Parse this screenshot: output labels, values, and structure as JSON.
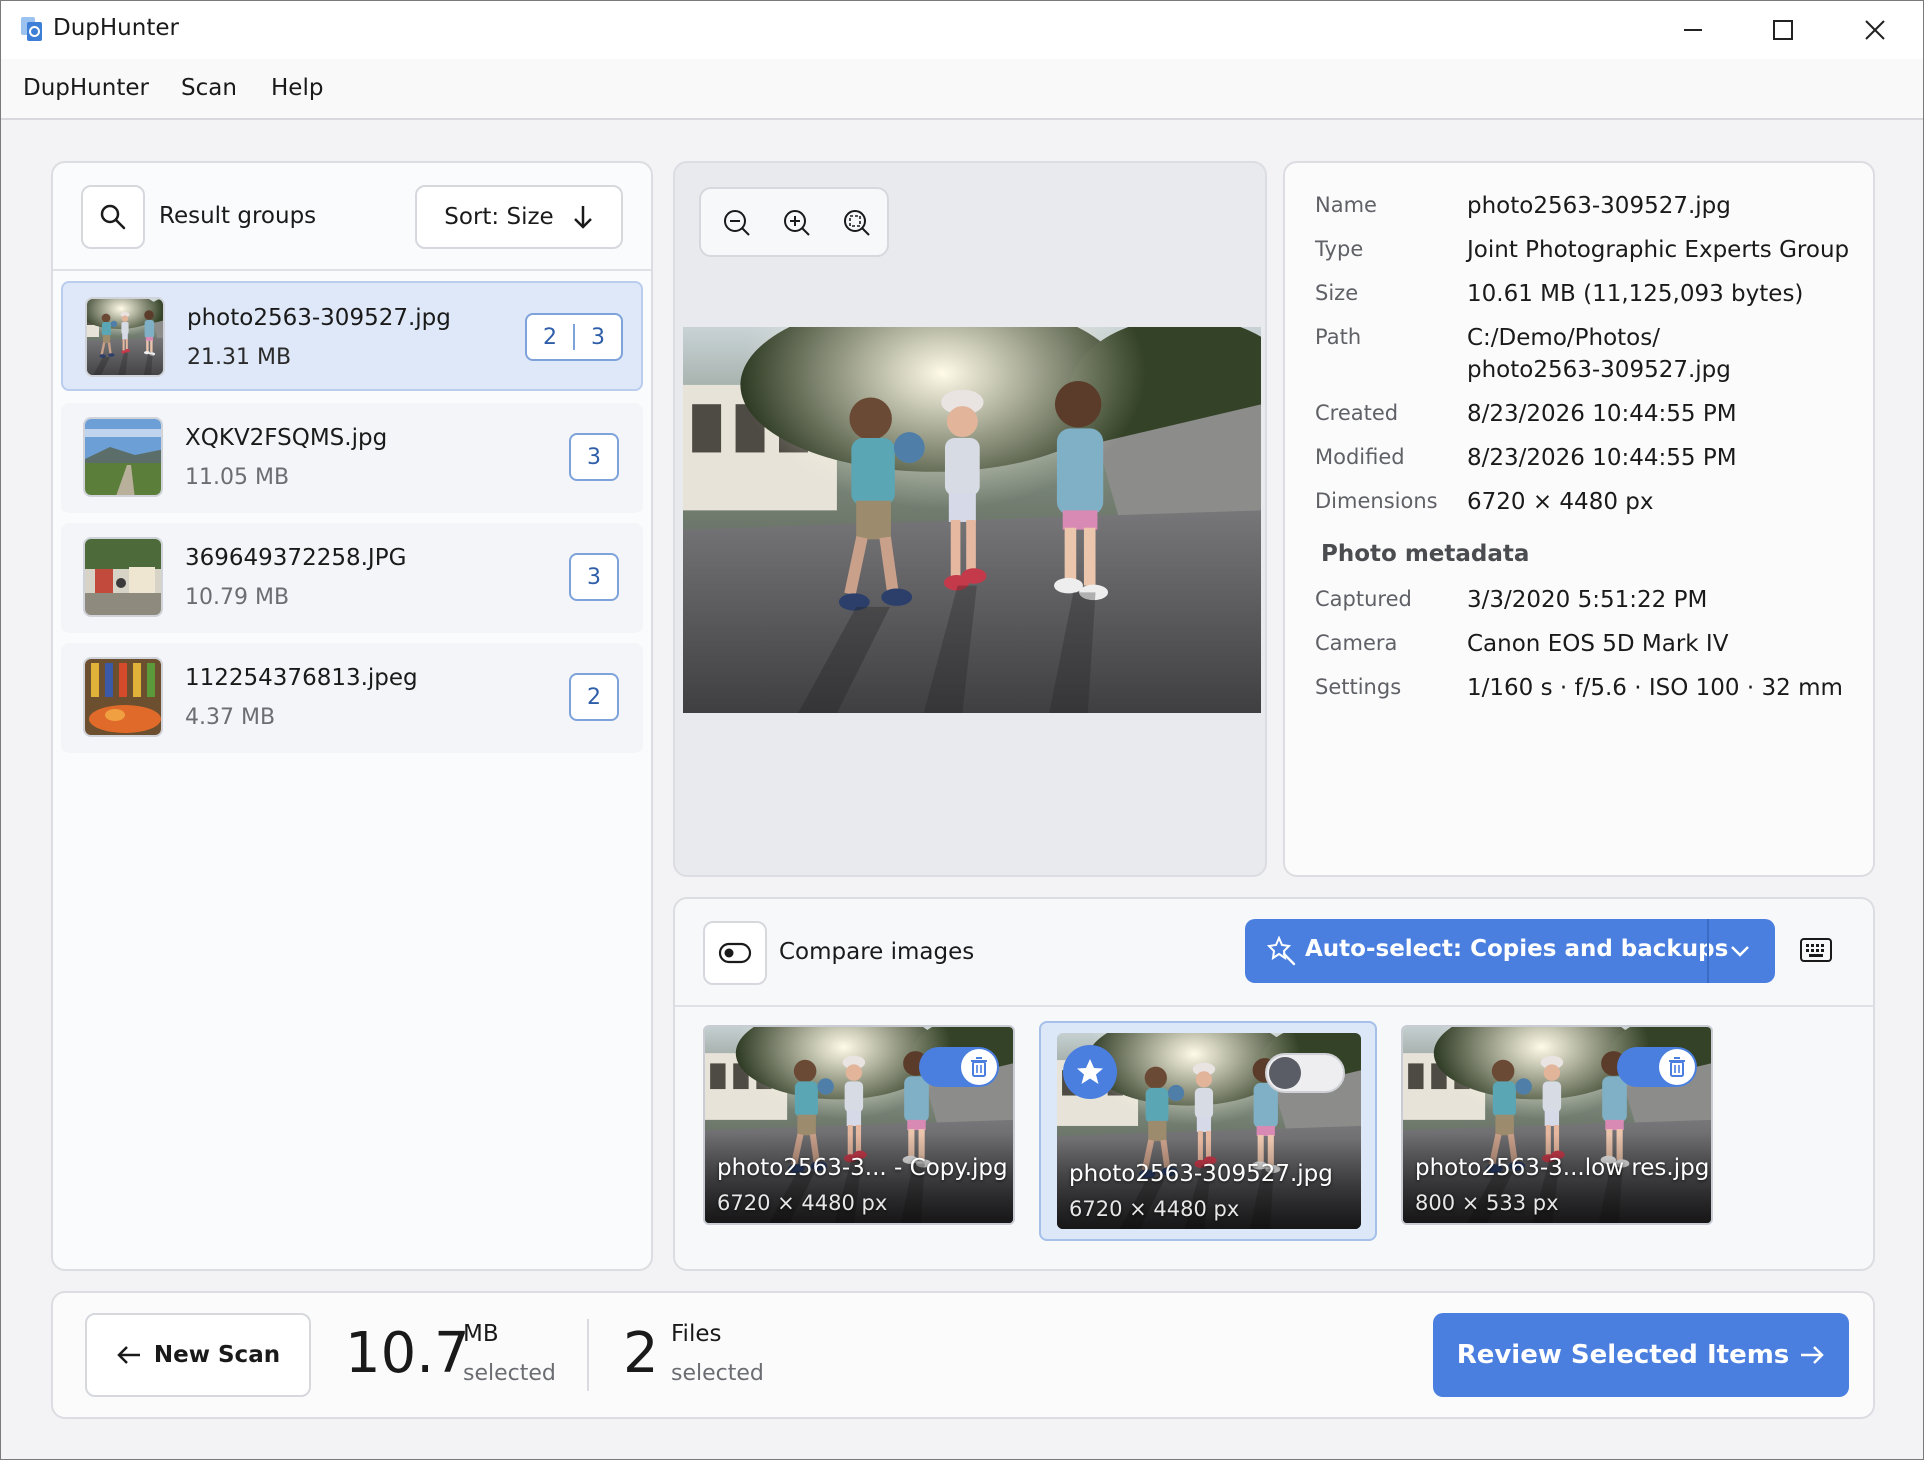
{
  "window": {
    "title": "DupHunter",
    "controls": [
      "minimize",
      "maximize",
      "close"
    ]
  },
  "menu": [
    "DupHunter",
    "Scan",
    "Help"
  ],
  "left": {
    "header": "Result groups",
    "sort_label": "Sort: Size",
    "items": [
      {
        "name": "photo2563-309527.jpg",
        "size": "21.31 MB",
        "badge_a": "2",
        "badge_b": "3",
        "selected": true
      },
      {
        "name": "XQKV2FSQMS.jpg",
        "size": "11.05 MB",
        "badge_b": "3"
      },
      {
        "name": "369649372258.JPG",
        "size": "10.79 MB",
        "badge_b": "3"
      },
      {
        "name": "112254376813.jpeg",
        "size": "4.37 MB",
        "badge_b": "2"
      }
    ]
  },
  "info": {
    "rows": [
      {
        "label": "Name",
        "value": "photo2563-309527.jpg"
      },
      {
        "label": "Type",
        "value": "Joint Photographic Experts Group"
      },
      {
        "label": "Size",
        "value": "10.61 MB (11,125,093 bytes)"
      },
      {
        "label": "Path",
        "value": "C:/Demo/Photos/",
        "value2": "photo2563-309527.jpg"
      },
      {
        "label": "Created",
        "value": "8/23/2026 10:44:55 PM"
      },
      {
        "label": "Modified",
        "value": "8/23/2026 10:44:55 PM"
      },
      {
        "label": "Dimensions",
        "value": "6720 × 4480 px"
      }
    ],
    "meta_heading": "Photo metadata",
    "meta_rows": [
      {
        "label": "Captured",
        "value": "3/3/2020 5:51:22 PM"
      },
      {
        "label": "Camera",
        "value": "Canon EOS 5D Mark IV"
      },
      {
        "label": "Settings",
        "value": "1/160 s · f/5.6 · ISO 100 · 32 mm"
      }
    ]
  },
  "compare": {
    "label": "Compare images",
    "auto_select": "Auto-select: Copies and backups",
    "cards": [
      {
        "name": "photo2563-3... - Copy.jpg",
        "dims": "6720 × 4480 px",
        "marked": true
      },
      {
        "name": "photo2563-309527.jpg",
        "dims": "6720 × 4480 px",
        "marked": false,
        "original": true
      },
      {
        "name": "photo2563-3...low res.jpg",
        "dims": "800 × 533 px",
        "marked": true
      }
    ]
  },
  "footer": {
    "new_scan": "New Scan",
    "mb_value": "10.7",
    "mb_unit": "MB",
    "mb_sub": "selected",
    "files_value": "2",
    "files_unit": "Files",
    "files_sub": "selected",
    "review": "Review Selected Items"
  },
  "colors": {
    "accent": "#4a7fe0",
    "accent_dark": "#3b6cc5",
    "selection": "#dfe8f8",
    "badge_border": "#7ea3da"
  }
}
